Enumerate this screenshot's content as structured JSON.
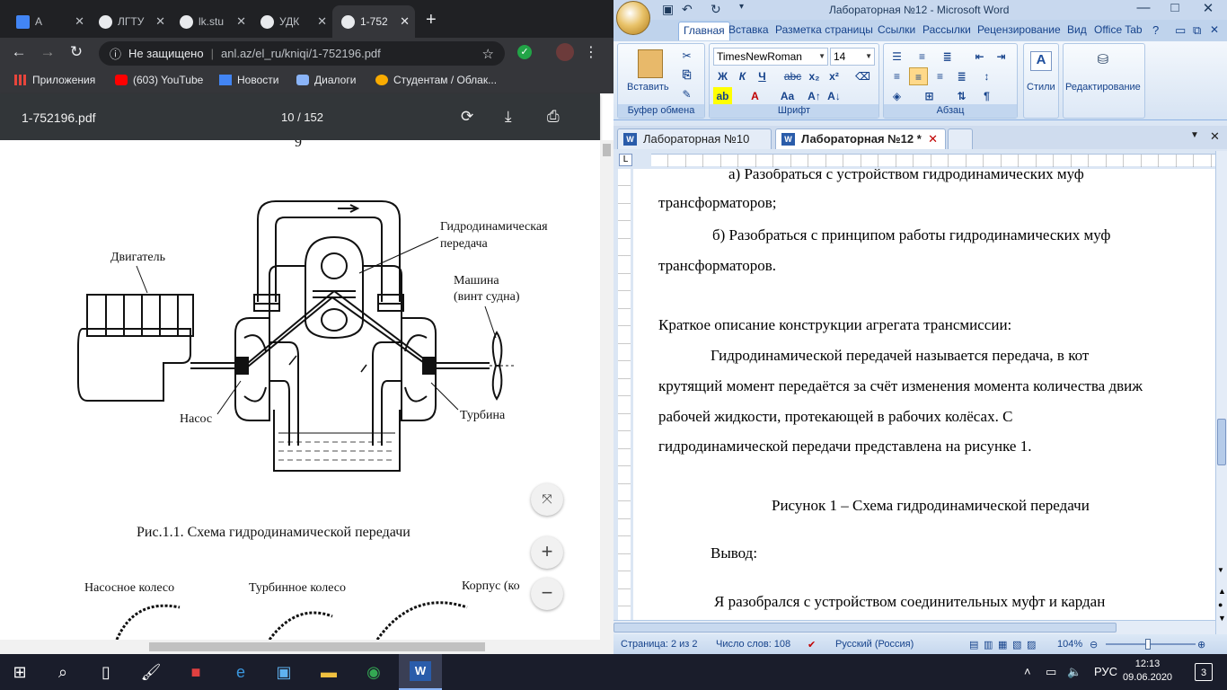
{
  "chrome": {
    "tabs": [
      {
        "label": "A",
        "active": false
      },
      {
        "label": "ЛГТУ",
        "active": false
      },
      {
        "label": "lk.stu",
        "active": false
      },
      {
        "label": "УДК",
        "active": false
      },
      {
        "label": "1-752",
        "active": true
      }
    ],
    "omnibox": {
      "security": "Не защищено",
      "url": "anl.az/el_ru/kniqi/1-752196.pdf"
    },
    "bookmarks": [
      {
        "label": "Приложения",
        "icon": "apps-icon",
        "color": "#e8453c"
      },
      {
        "label": "(603) YouTube",
        "icon": "youtube-icon",
        "color": "#ff0000"
      },
      {
        "label": "Новости",
        "icon": "news-icon",
        "color": "#4285f4"
      },
      {
        "label": "Диалоги",
        "icon": "chat-icon",
        "color": "#8ab4f8"
      },
      {
        "label": "Студентам / Облак...",
        "icon": "cloud-icon",
        "color": "#f9ab00"
      }
    ]
  },
  "pdf": {
    "title": "1-752196.pdf",
    "page_indicator": "10 / 152",
    "page_number": "9",
    "labels": {
      "engine": "Двигатель",
      "transmission_1": "Гидродинамическая",
      "transmission_2": "передача",
      "machine_1": "Машина",
      "machine_2": "(винт судна)",
      "pump": "Насос",
      "turbine": "Турбина",
      "pump_wheel": "Насосное колесо",
      "turbine_wheel": "Турбинное колесо",
      "housing": "Корпус (ко"
    },
    "caption": "Рис.1.1. Схема гидродинамической передачи"
  },
  "word": {
    "title": "Лабораторная №12 - Microsoft Word",
    "ribbon_tabs": [
      "Главная",
      "Вставка",
      "Разметка страницы",
      "Ссылки",
      "Рассылки",
      "Рецензирование",
      "Вид",
      "Office Tab"
    ],
    "clipboard": {
      "paste": "Вставить",
      "group": "Буфер обмена"
    },
    "font": {
      "name": "TimesNewRoman",
      "size": "14",
      "group": "Шрифт"
    },
    "paragraph_group": "Абзац",
    "styles": "Стили",
    "editing": "Редактирование",
    "doc_tabs": [
      {
        "label": "Лабораторная №10",
        "active": false
      },
      {
        "label": "Лабораторная №12 *",
        "active": true
      }
    ],
    "lines": [
      "а)   Разобраться   с   устройством   гидродинамических   муф",
      "трансформаторов;",
      "б)  Разобраться  с  принципом  работы  гидродинамических  муф",
      "трансформаторов.",
      "Краткое описание  конструкции  агрегата  трансмиссии:",
      "Гидродинамической    передачей    называется    передача,    в    кот",
      "крутящий момент передаётся за счёт изменения момента количества движ",
      "рабочей      жидкости,      протекающей      в      рабочих      колёсах.      С",
      "гидродинамической передачи представлена  на рисунке  1.",
      "Рисунок 1 – Схема гидродинамической  передачи",
      "Вывод:",
      "Я   разобрался   с   устройством   соединительных   муфт   и   кардан"
    ],
    "status": {
      "page": "Страница: 2 из 2",
      "words": "Число слов: 108",
      "lang": "Русский (Россия)",
      "zoom": "104%"
    }
  },
  "taskbar": {
    "lang": "РУС",
    "time": "12:13",
    "date": "09.06.2020",
    "notifications": "3"
  }
}
